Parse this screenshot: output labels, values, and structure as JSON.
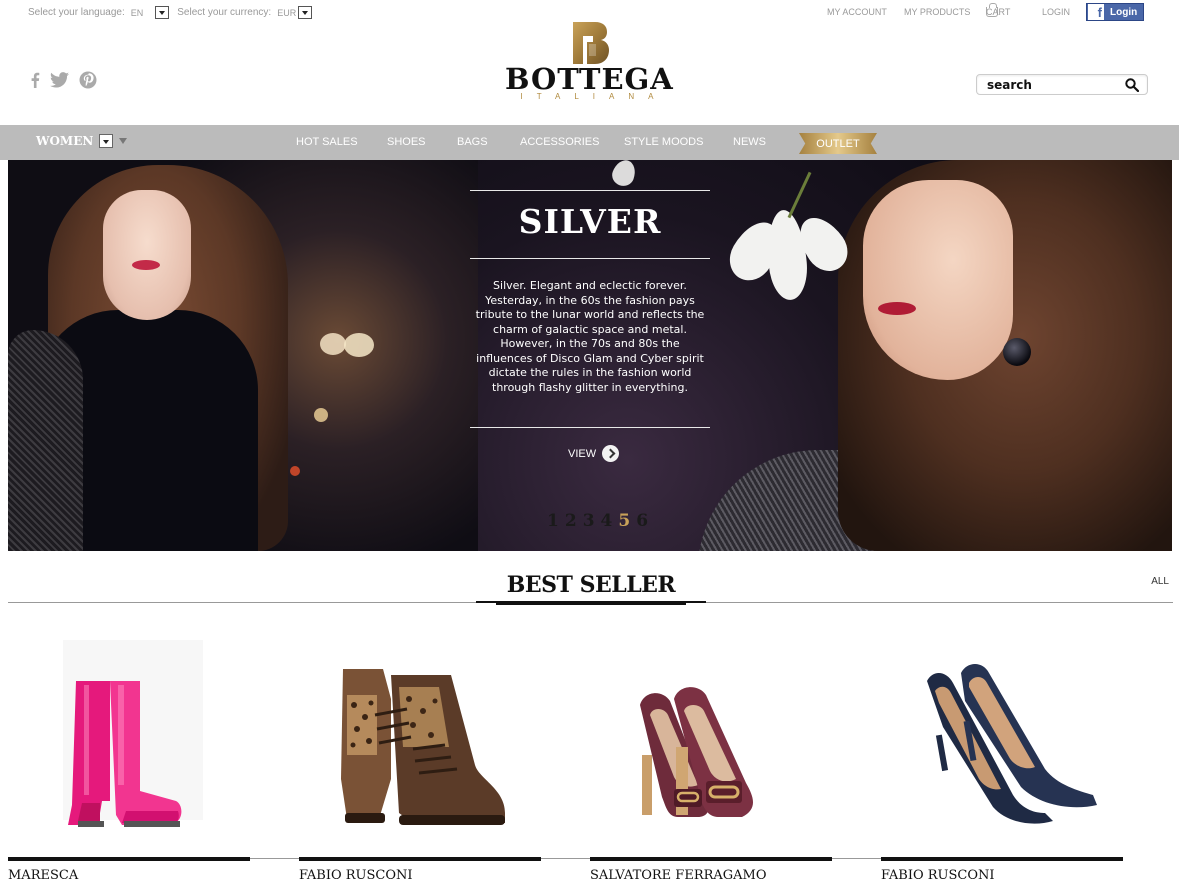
{
  "topbar": {
    "language_label": "Select your language:",
    "language_value": "EN",
    "currency_label": "Select your currency:",
    "currency_value": "EUR",
    "my_account": "MY ACCOUNT",
    "my_products": "MY PRODUCTS",
    "cart": "CART",
    "login": "LOGIN",
    "facebook_login": "Login"
  },
  "brand": {
    "name": "BOTTEGA",
    "tagline": "ITALIANA",
    "gold_color": "#b08a3e"
  },
  "search": {
    "placeholder": "search"
  },
  "nav": {
    "department": "WOMEN",
    "items": [
      "HOT SALES",
      "SHOES",
      "BAGS",
      "ACCESSORIES",
      "STYLE MOODS",
      "NEWS"
    ],
    "outlet": "OUTLET"
  },
  "hero": {
    "title": "SILVER",
    "description": "Silver. Elegant and eclectic forever. Yesterday, in the 60s the fashion pays tribute to the lunar world and reflects the charm of galactic space and metal. However, in the 70s and 80s the influences of Disco Glam and Cyber spirit dictate the rules in the fashion world through flashy glitter in everything.",
    "cta": "VIEW",
    "pages": [
      "1",
      "2",
      "3",
      "4",
      "5",
      "6"
    ],
    "active_page": "5"
  },
  "best_seller": {
    "title": "BEST SELLER",
    "all_link": "ALL",
    "products": [
      {
        "brand": "MARESCA",
        "image": "pink rain boots"
      },
      {
        "brand": "FABIO RUSCONI",
        "image": "leopard lace-up wedge boots"
      },
      {
        "brand": "SALVATORE FERRAGAMO",
        "image": "burgundy pumps with gancini buckle"
      },
      {
        "brand": "FABIO RUSCONI",
        "image": "navy suede pointed pumps"
      }
    ]
  }
}
